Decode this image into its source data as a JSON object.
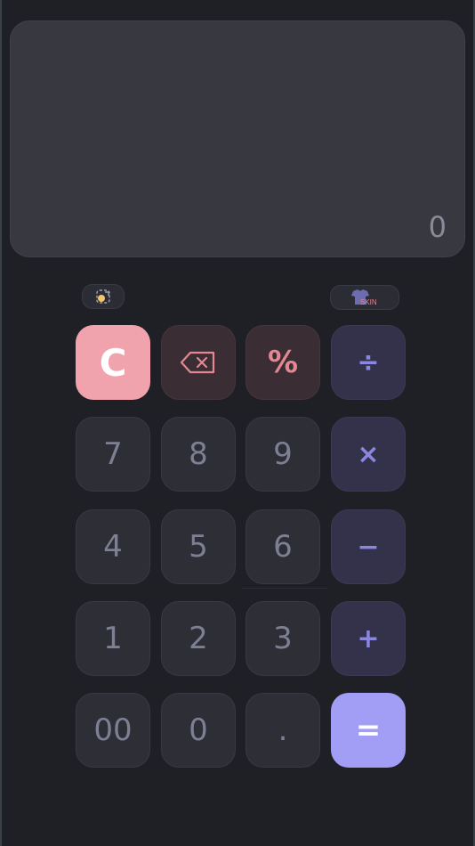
{
  "display": {
    "value": "0"
  },
  "toolbar": {
    "theme_icon": "theme-swap-icon",
    "skin_icon": "shirt-icon",
    "skin_text": "SKIN"
  },
  "keys": {
    "clear": "C",
    "backspace_icon": "backspace-icon",
    "percent": "%",
    "divide": "÷",
    "seven": "7",
    "eight": "8",
    "nine": "9",
    "multiply": "×",
    "four": "4",
    "five": "5",
    "six": "6",
    "minus": "−",
    "one": "1",
    "two": "2",
    "three": "3",
    "plus": "+",
    "double_zero": "00",
    "zero": "0",
    "dot": ".",
    "equals": "="
  },
  "colors": {
    "background": "#1f1f26",
    "display": "#383841",
    "number_key": "#2e2e37",
    "operator_key": "#33324a",
    "clear_key": "#f0a3ac",
    "equals_key": "#a29ef5",
    "accent_red": "#e48792",
    "accent_purple": "#8b86e0"
  }
}
